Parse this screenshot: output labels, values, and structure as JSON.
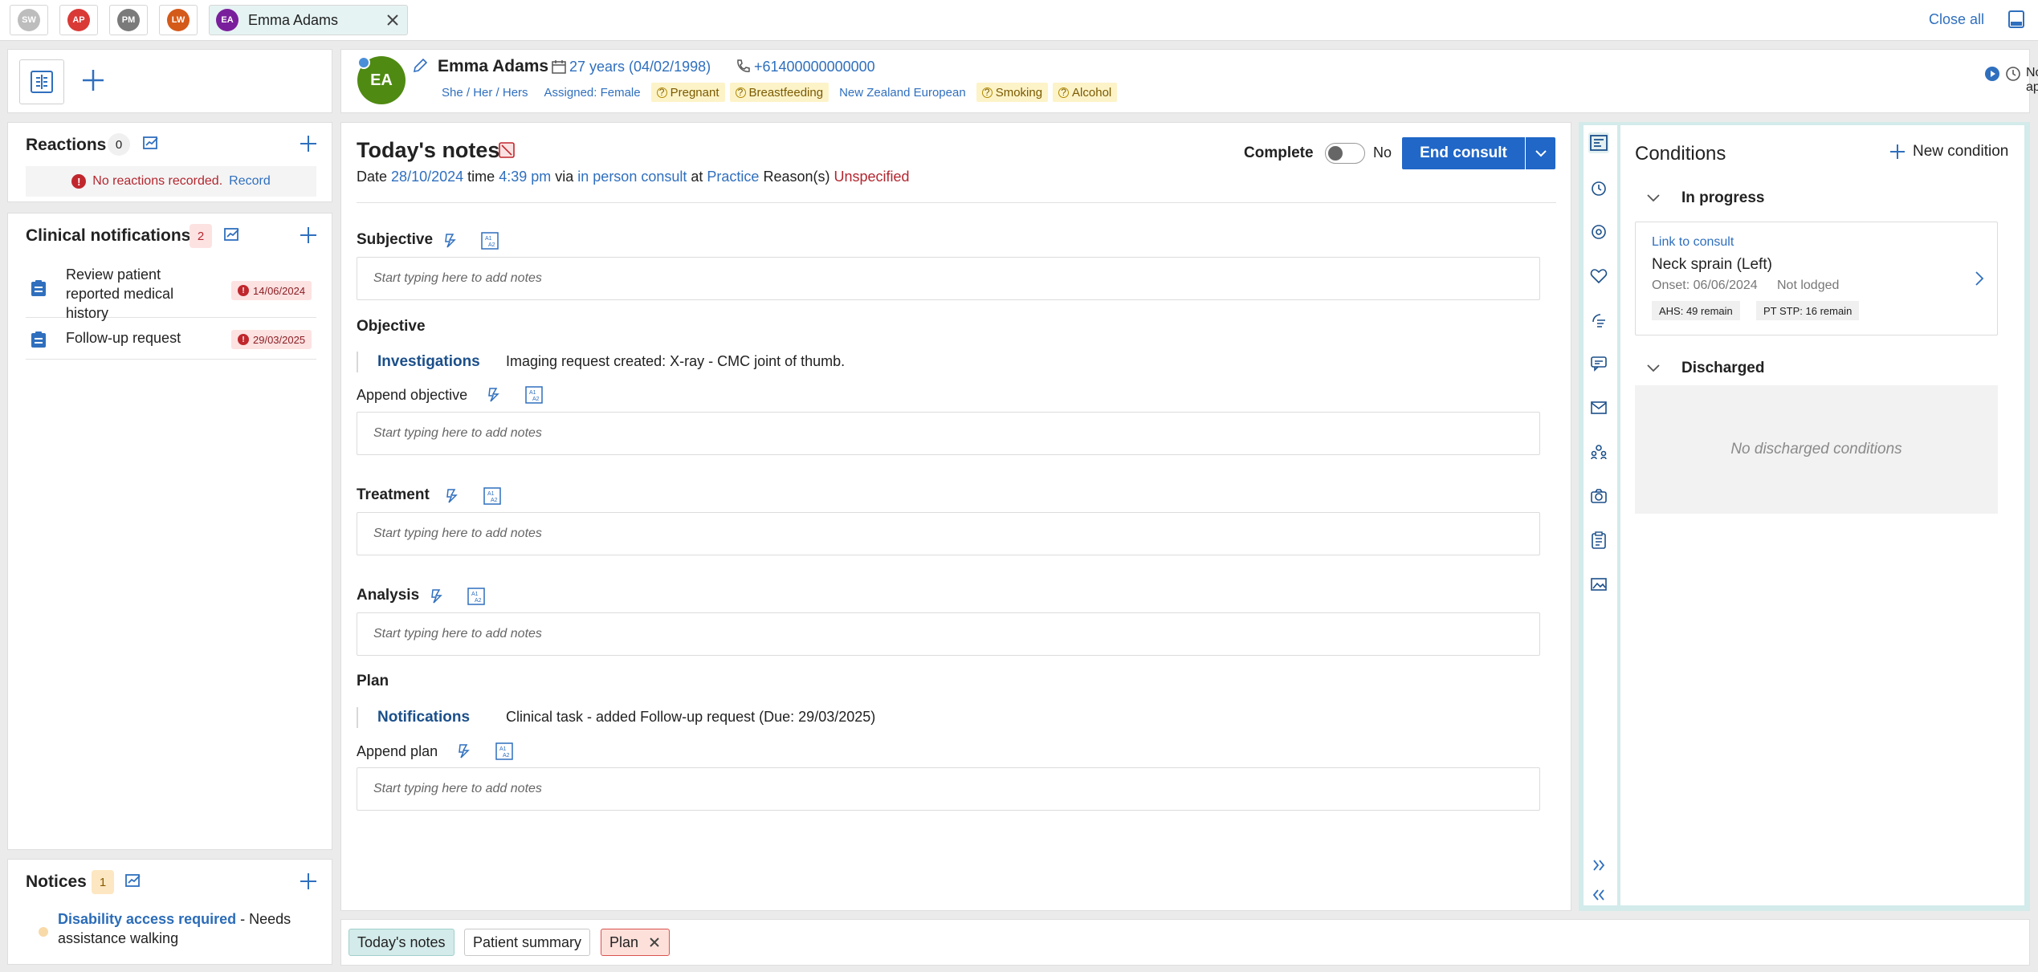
{
  "top_tabs": [
    {
      "initials": "SW",
      "color": "#bdbdbd"
    },
    {
      "initials": "AP",
      "color": "#d93a36"
    },
    {
      "initials": "PM",
      "color": "#7a7a7a"
    },
    {
      "initials": "LW",
      "color": "#d45a1a"
    }
  ],
  "active_tab": {
    "initials": "EA",
    "name": "Emma Adams",
    "color": "#7a1f9c"
  },
  "close_all": "Close all",
  "patient": {
    "initials": "EA",
    "avatar_color": "#4f8a12",
    "name": "Emma Adams",
    "age": "27 years (04/02/1998)",
    "phone": "+61400000000000",
    "pronouns": "She / Her / Hers",
    "assigned": "Assigned: Female",
    "tags": [
      "Pregnant",
      "Breastfeeding"
    ],
    "ethnicity": "New Zealand European",
    "tags2": [
      "Smoking",
      "Alcohol"
    ],
    "appt": "No appt."
  },
  "reactions": {
    "title": "Reactions",
    "count": "0",
    "empty_text": "No reactions recorded.",
    "record_link": "Record"
  },
  "clinical_notifications": {
    "title": "Clinical notifications",
    "count": "2",
    "items": [
      {
        "label": "Review patient reported medical history",
        "date": "14/06/2024"
      },
      {
        "label": "Follow-up request",
        "date": "29/03/2025"
      }
    ]
  },
  "notices": {
    "title": "Notices",
    "count": "1",
    "item_link": "Disability access required",
    "item_text": " - Needs assistance walking"
  },
  "notes": {
    "title": "Today's notes",
    "date_prefix": "Date",
    "date": "28/10/2024",
    "time_prefix": "time",
    "time": "4:39 pm",
    "via_prefix": "via",
    "via": "in person consult",
    "at_prefix": "at",
    "at": "Practice",
    "reason_prefix": "Reason(s)",
    "reason": "Unspecified",
    "complete_label": "Complete",
    "complete_value": "No",
    "end_consult": "End consult",
    "placeholder": "Start typing here to add notes",
    "subjective": "Subjective",
    "objective": "Objective",
    "investigations_label": "Investigations",
    "investigations_text": "Imaging request created: X-ray - CMC joint of thumb.",
    "append_objective": "Append objective",
    "treatment": "Treatment",
    "analysis": "Analysis",
    "plan": "Plan",
    "notifications_label": "Notifications",
    "notifications_text": "Clinical task - added Follow-up request (Due: 29/03/2025)",
    "append_plan": "Append plan"
  },
  "conditions": {
    "title": "Conditions",
    "new_condition": "New condition",
    "in_progress": "In progress",
    "link_to_consult": "Link to consult",
    "condition_name": "Neck sprain (Left)",
    "onset": "Onset: 06/06/2024",
    "lodged": "Not lodged",
    "badge1": "AHS: 49 remain",
    "badge2": "PT STP: 16 remain",
    "discharged": "Discharged",
    "no_discharged": "No discharged conditions"
  },
  "bottom_tabs": [
    "Today's notes",
    "Patient summary",
    "Plan"
  ],
  "icons": [
    "dashboard-icon",
    "plus-icon",
    "edit-icon",
    "calendar-icon",
    "phone-icon",
    "play-icon",
    "clock-icon",
    "chart-icon",
    "bolt-icon",
    "ab-icon",
    "chevron-down-icon",
    "chevron-right-icon",
    "close-icon",
    "layout-icon",
    "history-icon",
    "sidebar-icon"
  ]
}
